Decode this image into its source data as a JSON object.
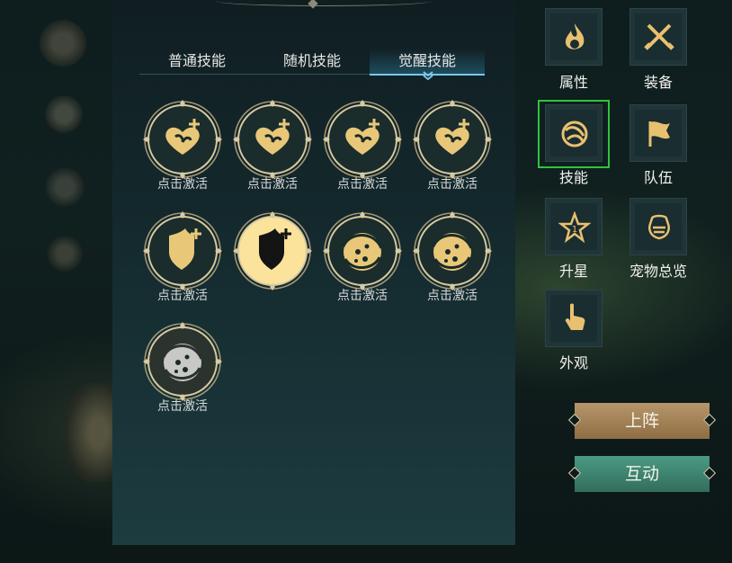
{
  "tabs": [
    {
      "label": "普通技能",
      "active": false
    },
    {
      "label": "随机技能",
      "active": false
    },
    {
      "label": "觉醒技能",
      "active": true
    }
  ],
  "skills": [
    {
      "icon": "heart-plus-icon",
      "label": "点击激活",
      "state": "inactive"
    },
    {
      "icon": "heart-plus-icon",
      "label": "点击激活",
      "state": "inactive"
    },
    {
      "icon": "heart-plus-icon",
      "label": "点击激活",
      "state": "inactive"
    },
    {
      "icon": "heart-plus-icon",
      "label": "点击激活",
      "state": "inactive"
    },
    {
      "icon": "shield-plus-icon",
      "label": "点击激活",
      "state": "inactive"
    },
    {
      "icon": "shield-plus-icon",
      "label": "",
      "state": "active"
    },
    {
      "icon": "vortex-icon",
      "label": "点击激活",
      "state": "inactive"
    },
    {
      "icon": "vortex-icon",
      "label": "点击激活",
      "state": "inactive"
    },
    {
      "icon": "vortex-icon",
      "label": "点击激活",
      "state": "locked"
    }
  ],
  "side_menu": [
    {
      "label": "属性",
      "icon": "flame-icon"
    },
    {
      "label": "装备",
      "icon": "crossed-swords-icon"
    },
    {
      "label": "技能",
      "icon": "skill-orb-icon",
      "selected": true
    },
    {
      "label": "队伍",
      "icon": "flag-icon"
    },
    {
      "label": "升星",
      "icon": "star-icon"
    },
    {
      "label": "宠物总览",
      "icon": "pet-icon"
    },
    {
      "label": "外观",
      "icon": "hand-icon"
    }
  ],
  "actions": {
    "deploy_label": "上阵",
    "interact_label": "互动"
  },
  "colors": {
    "gold": "#e8c878",
    "active_skill_bg": "#fbe39c",
    "tab_underline": "#7ac6e4",
    "selected_frame": "#30c43c",
    "deploy_button": "#a8864f",
    "interact_button": "#3e8874"
  }
}
